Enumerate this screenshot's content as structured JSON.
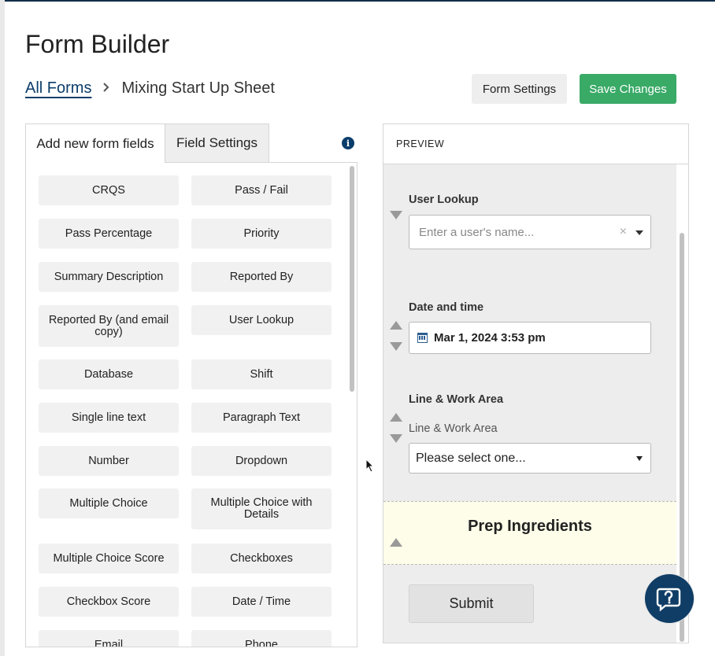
{
  "page": {
    "title": "Form Builder"
  },
  "breadcrumb": {
    "parent": "All Forms",
    "current": "Mixing Start Up Sheet"
  },
  "header_buttons": {
    "form_settings": "Form Settings",
    "save_changes": "Save Changes"
  },
  "left_tabs": {
    "add": "Add new form fields",
    "settings": "Field Settings"
  },
  "info_icon": "i",
  "fields": [
    "CRQS",
    "Pass / Fail",
    "Pass Percentage",
    "Priority",
    "Summary Description",
    "Reported By",
    "Reported By (and email copy)",
    "User Lookup",
    "Database",
    "Shift",
    "Single line text",
    "Paragraph Text",
    "Number",
    "Dropdown",
    "Multiple Choice",
    "Multiple Choice with Details",
    "Multiple Choice Score",
    "Checkboxes",
    "Checkbox Score",
    "Date / Time",
    "Email",
    "Phone"
  ],
  "preview": {
    "header": "PREVIEW",
    "user_lookup_label": "User Lookup",
    "user_lookup_placeholder": "Enter a user's name...",
    "clear_icon": "×",
    "date_label": "Date and time",
    "date_value": "Mar 1, 2024 3:53 pm",
    "line_label": "Line & Work Area",
    "line_sublabel": "Line & Work Area",
    "line_select": "Please select one...",
    "section_title": "Prep Ingredients",
    "submit": "Submit"
  },
  "colors": {
    "brand": "#0b3d6b",
    "save": "#3aaa67",
    "section_bg": "#fdfde9"
  },
  "icons": [
    "info-icon",
    "chevron-right-icon",
    "calendar-icon",
    "clear-icon",
    "caret-down-icon",
    "arrow-up-icon",
    "arrow-down-icon",
    "help-icon"
  ]
}
